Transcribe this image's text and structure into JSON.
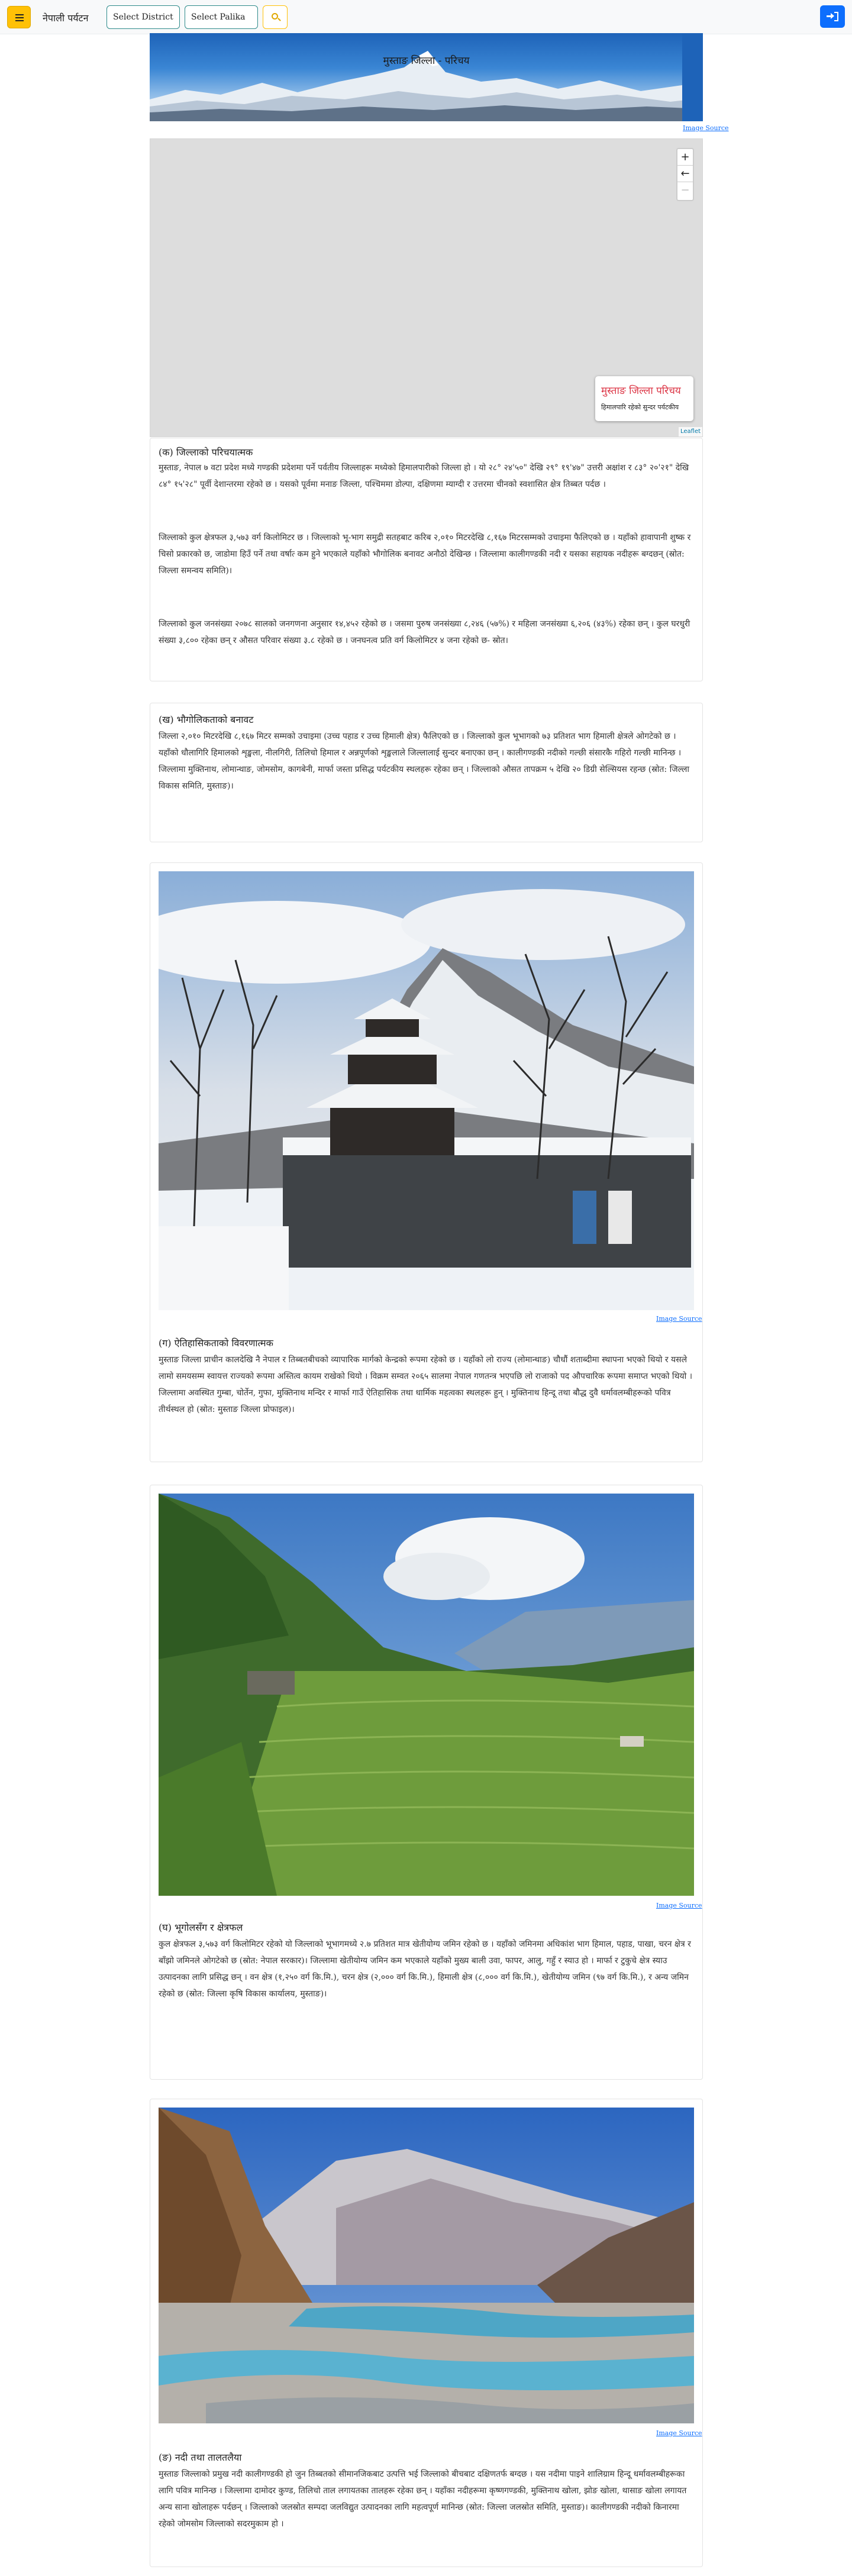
{
  "navbar": {
    "brand": "नेपाली पर्यटन",
    "district_select": "Select District",
    "palika_select": "Select Palika",
    "colors": {
      "menu": "#ffc107",
      "login": "#0d6efd"
    }
  },
  "hero": {
    "title": "मुस्ताङ जिल्ला - परिचय",
    "image_source": "Image Source"
  },
  "map": {
    "zoom_in": "+",
    "zoom_out": "−",
    "info_title": "मुस्ताङ जिल्ला परिचय",
    "info_subtitle": "हिमालपारि रहेको सुन्दर पर्यटकीय",
    "attribution": "Leaflet"
  },
  "sections": [
    {
      "title": "(क) जिल्लाको परिचयात्मक",
      "paragraphs": [
        "मुस्ताङ, नेपाल ७ वटा प्रदेश मध्ये गण्डकी प्रदेशमा पर्ने पर्वतीय जिल्लाहरू मध्येको हिमालपारीको जिल्ला हो । यो २८° २४'५०\" देखि २९° १९'४७\" उत्तरी अक्षांश र ८३° २०'२१\" देखि ८४° १५'२८\" पूर्वी देशान्तरमा रहेको छ । यसको पूर्वमा मनाङ जिल्ला, पश्चिममा डोल्पा, दक्षिणमा म्याग्दी र उत्तरमा चीनको स्वशासित क्षेत्र तिब्बत पर्दछ ।",
        "जिल्लाको कुल क्षेत्रफल ३,५७३ वर्ग किलोमिटर छ । जिल्लाको भू-भाग समुद्री सतहबाट करिब २,०१० मिटरदेखि ८,१६७ मिटरसम्मको उचाइमा फैलिएको छ । यहाँको हावापानी शुष्क र चिसो प्रकारको छ, जाडोमा हिउँ पर्ने तथा वर्षात्‍ कम हुने भएकाले यहाँको भौगोलिक बनावट अनौठो देखिन्छ । जिल्लामा कालीगण्डकी नदी र यसका सहायक नदीहरू बग्दछन् (स्रोत: जिल्ला समन्वय समिति)।",
        "जिल्लाको कुल जनसंख्या २०७८ सालको जनगणना अनुसार १४,४५२ रहेको छ । जसमा पुरुष जनसंख्या ८,२४६ (५७%) र महिला जनसंख्या ६,२०६ (४३%) रहेका छन् । कुल घरधुरी संख्या ३,८०० रहेका छन् र औसत परिवार संख्या ३.८ रहेको छ । जनघनत्व प्रति वर्ग किलोमिटर ४ जना रहेको छ- स्रोत।"
      ]
    },
    {
      "title": "(ख) भौगोलिकताको बनावट",
      "paragraphs": [
        "जिल्ला २,०१० मिटरदेखि ८,१६७ मिटर सम्मको उचाइमा (उच्च पहाड र उच्च हिमाली क्षेत्र) फैलिएको छ । जिल्लाको कुल भूभागको ७३ प्रतिशत भाग हिमाली क्षेत्रले ओगटेको छ । यहाँको धौलागिरि हिमालको शृङ्खला, नीलगिरी, तिलिचो हिमाल र अन्नपूर्णको शृङ्खलाले जिल्लालाई सुन्दर बनाएका छन् । कालीगण्डकी नदीको गल्छी संसारकै गहिरो गल्छी मानिन्छ । जिल्लामा मुक्तिनाथ, लोमान्थाङ, जोमसोम, कागबेनी, मार्फा जस्ता प्रसिद्ध पर्यटकीय स्थलहरू रहेका छन् । जिल्लाको औसत तापक्रम ५ देखि २० डिग्री सेल्सियस रहन्छ (स्रोत: जिल्ला विकास समिति, मुस्ताङ)।"
      ]
    },
    {
      "title": "(ग) ऐतिहासिकताको विवरणात्मक",
      "paragraphs": [
        "मुस्ताङ जिल्ला प्राचीन कालदेखि नै नेपाल र तिब्बतबीचको व्यापारिक मार्गको केन्द्रको रूपमा रहेको छ । यहाँको लो राज्य (लोमान्थाङ) चौधौं शताब्दीमा स्थापना भएको थियो र यसले लामो समयसम्म स्वायत्त राज्यको रूपमा अस्तित्व कायम राखेको थियो । विक्रम सम्वत २०६५ सालमा नेपाल गणतन्त्र भएपछि लो राजाको पद औपचारिक रूपमा समाप्त भएको थियो । जिल्लामा अवस्थित गुम्बा, चोर्तेन, गुफा, मुक्तिनाथ मन्दिर र मार्फा गाउँ ऐतिहासिक तथा धार्मिक महत्वका स्थलहरू हुन् । मुक्तिनाथ हिन्दू तथा बौद्ध दुवै धर्मावलम्बीहरूको पवित्र तीर्थस्थल हो (स्रोत: मुस्ताङ जिल्ला प्रोफाइल)।"
      ]
    },
    {
      "title": "(घ) भूगोलसँग र क्षेत्रफल",
      "paragraphs": [
        "कुल क्षेत्रफल ३,५७३ वर्ग किलोमिटर रहेको यो जिल्लाको भूभागमध्ये २.७ प्रतिशत मात्र खेतीयोग्य जमिन रहेको छ । यहाँको जमिनमा अधिकांश भाग हिमाल, पहाड, पाखा, चरन क्षेत्र र बाँझो जमिनले ओगटेको छ (स्रोत: नेपाल सरकार)। जिल्लामा खेतीयोग्य जमिन कम भएकाले यहाँको मुख्य बाली उवा, फापर, आलु, गहुँ र स्याउ हो । मार्फा र टुकुचे क्षेत्र स्याउ उत्पादनका लागि प्रसिद्ध छन् । वन क्षेत्र (१,२५० वर्ग कि.मि.), चरन क्षेत्र (२,००० वर्ग कि.मि.), हिमाली क्षेत्र (८,००० वर्ग कि.मि.), खेतीयोग्य जमिन (९७ वर्ग कि.मि.), र अन्य जमिन रहेको छ (स्रोत: जिल्ला कृषि विकास कार्यालय, मुस्ताङ)।"
      ]
    },
    {
      "title": "(ङ) नदी तथा तालतलैया",
      "paragraphs": [
        "मुस्ताङ जिल्लाको प्रमुख नदी कालीगण्डकी हो जुन तिब्बतको सीमानजिकबाट उत्पत्ति भई जिल्लाको बीचबाट दक्षिणतर्फ बग्दछ । यस नदीमा पाइने शालिग्राम हिन्दू धर्मावलम्बीहरूका लागि पवित्र मानिन्छ । जिल्लामा दामोदर कुण्ड, तिलिचो ताल लगायतका तालहरू रहेका छन् । यहाँका नदीहरूमा कृष्णगण्डकी, मुक्तिनाथ खोला, झोङ खोला, थासाङ खोला लगायत अन्य साना खोलाहरू पर्दछन् । जिल्लाको जलस्रोत सम्पदा जलविद्युत उत्पादनका लागि महत्वपूर्ण मानिन्छ (स्रोत: जिल्ला जलस्रोत समिति, मुस्ताङ)। कालीगण्डकी नदीको किनारमा रहेको जोमसोम जिल्लाको सदरमुकाम हो ।"
      ]
    }
  ]
}
